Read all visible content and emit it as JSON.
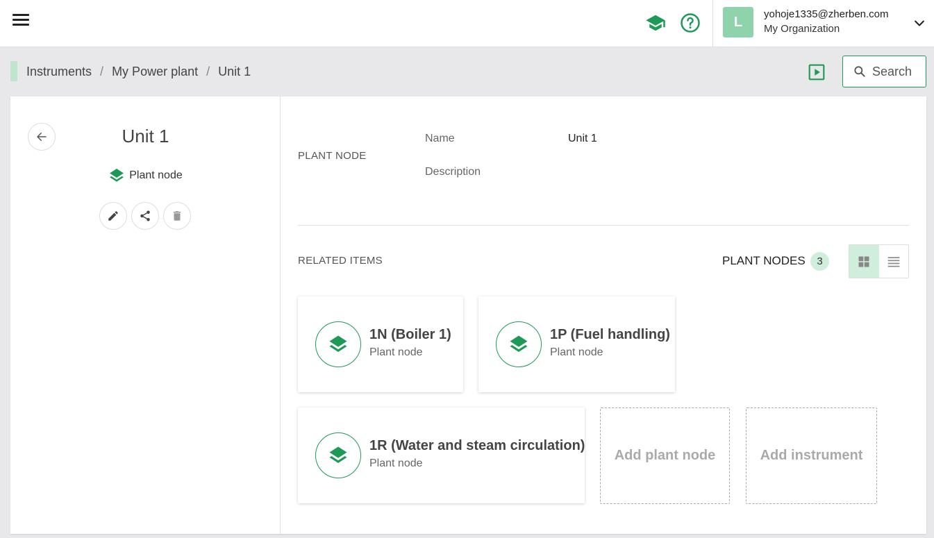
{
  "header": {
    "user_initial": "L",
    "user_email": "yohoje1335@zherben.com",
    "organization": "My Organization"
  },
  "breadcrumb": {
    "items": [
      "Instruments",
      "My Power plant",
      "Unit 1"
    ],
    "separator": "/"
  },
  "search": {
    "label": "Search"
  },
  "node": {
    "title": "Unit 1",
    "type_label": "Plant node"
  },
  "details": {
    "section_label": "PLANT NODE",
    "name_key": "Name",
    "name_value": "Unit 1",
    "description_key": "Description",
    "description_value": ""
  },
  "related": {
    "section_label": "RELATED ITEMS",
    "plant_nodes_label": "PLANT NODES",
    "plant_nodes_count": "3",
    "cards": [
      {
        "title": "1N (Boiler 1)",
        "subtitle": "Plant node"
      },
      {
        "title": "1P (Fuel handling)",
        "subtitle": "Plant node"
      },
      {
        "title": "1R (Water and steam circulation)",
        "subtitle": "Plant node"
      }
    ],
    "add_plant_node": "Add plant node",
    "add_instrument": "Add instrument"
  },
  "colors": {
    "accent": "#1e9a57",
    "accent_light": "#cfeedb",
    "avatar": "#8fd3ad"
  }
}
